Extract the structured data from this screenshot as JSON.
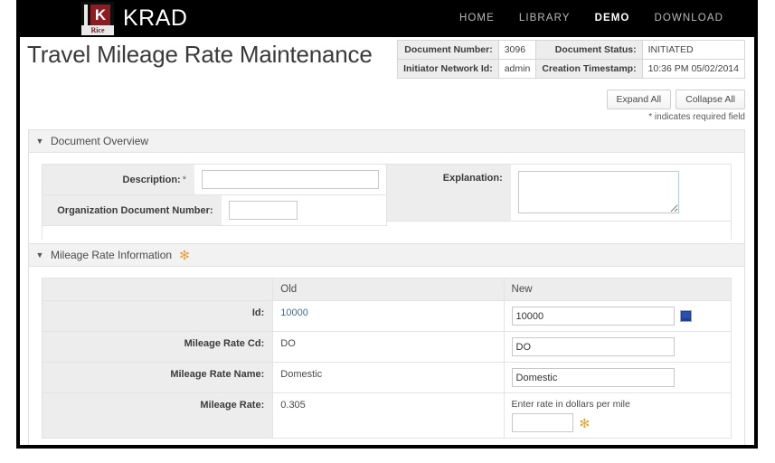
{
  "brand": {
    "logo_alt": "Rice",
    "logo_sub": "Rice",
    "logo_letter": "K",
    "name": "KRAD"
  },
  "nav": {
    "items": [
      {
        "label": "HOME",
        "active": false
      },
      {
        "label": "LIBRARY",
        "active": false
      },
      {
        "label": "DEMO",
        "active": true
      },
      {
        "label": "DOWNLOAD",
        "active": false
      }
    ]
  },
  "page": {
    "title": "Travel Mileage Rate Maintenance",
    "required_note": "* indicates required field"
  },
  "doc_info": {
    "rows": [
      {
        "label_a": "Document Number:",
        "value_a": "3096",
        "label_b": "Document Status:",
        "value_b": "INITIATED"
      },
      {
        "label_a": "Initiator Network Id:",
        "value_a": "admin",
        "label_b": "Creation Timestamp:",
        "value_b": "10:36 PM 05/02/2014"
      }
    ]
  },
  "toolbar": {
    "expand_all": "Expand All",
    "collapse_all": "Collapse All"
  },
  "sections": {
    "overview": {
      "title": "Document Overview",
      "caret": "▼",
      "fields": {
        "description_label": "Description:",
        "description_required": "*",
        "description_value": "",
        "org_doc_number_label": "Organization Document Number:",
        "org_doc_number_value": "",
        "explanation_label": "Explanation:",
        "explanation_value": ""
      }
    },
    "mileage": {
      "title": "Mileage Rate Information",
      "caret": "▼",
      "star": "✻",
      "columns": {
        "blank": "",
        "old": "Old",
        "new": "New"
      },
      "rows": [
        {
          "label": "Id:",
          "old": "10000",
          "old_is_link": true,
          "new_value": "10000",
          "new_hint": "",
          "has_lookup_icon": true,
          "has_star": false,
          "input_width": 180
        },
        {
          "label": "Mileage Rate Cd:",
          "old": "DO",
          "old_is_link": false,
          "new_value": "DO",
          "new_hint": "",
          "has_lookup_icon": false,
          "has_star": false,
          "input_width": 180
        },
        {
          "label": "Mileage Rate Name:",
          "old": "Domestic",
          "old_is_link": false,
          "new_value": "Domestic",
          "new_hint": "",
          "has_lookup_icon": false,
          "has_star": false,
          "input_width": 180
        },
        {
          "label": "Mileage Rate:",
          "old": "0.305",
          "old_is_link": false,
          "new_value": "",
          "new_hint": "Enter rate in dollars per mile",
          "has_lookup_icon": false,
          "has_star": true,
          "input_width": 68
        }
      ]
    }
  },
  "colors": {
    "topbar_bg": "#000000",
    "brand_red": "#8e1b22",
    "nav_active": "#ffffff",
    "nav_inactive": "#b9b9b9",
    "link_blue": "#3a6ea5",
    "star_orange": "#e8a33d",
    "panel_header_bg": "#f2f2f2",
    "label_bg": "#ededed",
    "focus_border": "#b7cddc",
    "lookup_icon_blue": "#1f3f8f"
  }
}
